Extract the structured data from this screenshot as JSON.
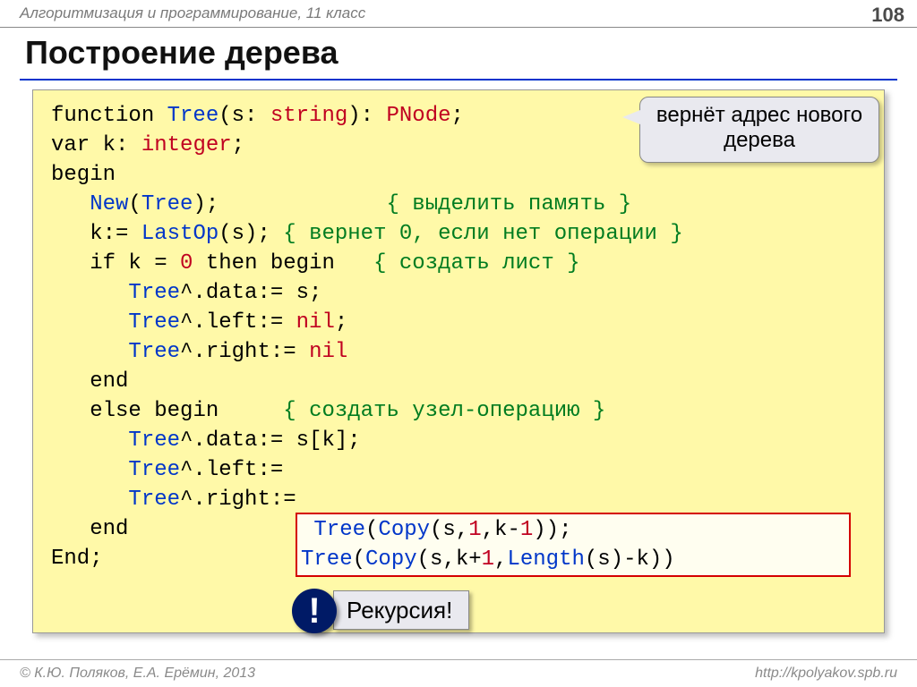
{
  "header": {
    "course": "Алгоритмизация и программирование, 11 класс",
    "page": "108"
  },
  "title": "Построение дерева",
  "callout": "вернёт адрес нового дерева",
  "code": {
    "sig_function": "function",
    "sig_name": "Tree",
    "sig_open": "(s: ",
    "sig_type1": "string",
    "sig_mid": "): ",
    "sig_ret": "PNode",
    "sig_end": ";",
    "var_kw": "var",
    "var_body": " k: ",
    "var_type": "integer",
    "var_end": ";",
    "begin": "begin",
    "l_new_a": "New",
    "l_new_b": "(",
    "l_new_c": "Tree",
    "l_new_d": ");",
    "cmt1": "{ выделить память }",
    "k_assign_a": "k:= ",
    "k_assign_b": "LastOp",
    "k_assign_c": "(s); ",
    "cmt2": "{ вернет 0, если нет операции }",
    "if_a": "if k = ",
    "if_zero": "0",
    "if_b": " then begin   ",
    "cmt3": "{ создать лист }",
    "d1_a": "Tree",
    "d1_b": "^.data:= s;",
    "l1_a": "Tree",
    "l1_b": "^.left:= ",
    "nil1": "nil",
    "l1_c": ";",
    "r1_a": "Tree",
    "r1_b": "^.right:= ",
    "nil2": "nil",
    "end1": "end",
    "else_kw": "else begin     ",
    "cmt4": "{ создать узел-операцию }",
    "d2_a": "Tree",
    "d2_b": "^.data:= s[k];",
    "l2_a": "Tree",
    "l2_b": "^.left:= ",
    "r2_a": "Tree",
    "r2_b": "^.right:=",
    "end2": "end",
    "end3": "End;"
  },
  "highlight": {
    "line1_a": "Tree",
    "line1_b": "(",
    "line1_c": "Copy",
    "line1_d": "(s,",
    "line1_e": "1",
    "line1_f": ",k-",
    "line1_g": "1",
    "line1_h": "));",
    "line2_a": "Tree",
    "line2_b": "(",
    "line2_c": "Copy",
    "line2_d": "(s,k+",
    "line2_e": "1",
    "line2_f": ",",
    "line2_g": "Length",
    "line2_h": "(s)-k))"
  },
  "bang": "!",
  "recursion": "Рекурсия!",
  "footer": {
    "left": "© К.Ю. Поляков, Е.А. Ерёмин, 2013",
    "right": "http://kpolyakov.spb.ru"
  }
}
